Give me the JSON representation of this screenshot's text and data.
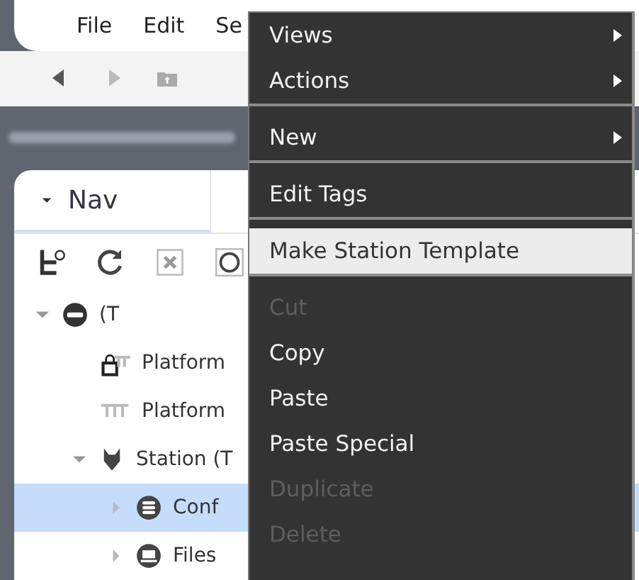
{
  "menu_bar": {
    "items": [
      "File",
      "Edit",
      "Se"
    ]
  },
  "nav_panel": {
    "tab": {
      "label": "Nav",
      "expanded": true
    },
    "tree": [
      {
        "label": "(T",
        "kind": "server",
        "expanded": true,
        "selected": false,
        "children": [
          {
            "label": "Platform",
            "kind": "platform-lock",
            "selected": false
          },
          {
            "label": "Platform",
            "kind": "platform",
            "selected": false
          },
          {
            "label": "Station (T",
            "kind": "station",
            "expanded": true,
            "selected": false,
            "children": [
              {
                "label": "Conf",
                "kind": "database",
                "expanded": false,
                "selected": true
              },
              {
                "label": "Files",
                "kind": "drive",
                "expanded": false,
                "selected": false
              }
            ]
          }
        ]
      }
    ]
  },
  "context_menu": {
    "items": [
      {
        "kind": "item",
        "label": "Views",
        "submenu": true,
        "disabled": false,
        "selected": false
      },
      {
        "kind": "item",
        "label": "Actions",
        "submenu": true,
        "disabled": false,
        "selected": false
      },
      {
        "kind": "separator"
      },
      {
        "kind": "item",
        "label": "New",
        "submenu": true,
        "disabled": false,
        "selected": false
      },
      {
        "kind": "separator"
      },
      {
        "kind": "item",
        "label": "Edit Tags",
        "submenu": false,
        "disabled": false,
        "selected": false
      },
      {
        "kind": "separator"
      },
      {
        "kind": "item",
        "label": "Make Station Template",
        "submenu": false,
        "disabled": false,
        "selected": true
      },
      {
        "kind": "separator"
      },
      {
        "kind": "item",
        "label": "Cut",
        "submenu": false,
        "disabled": true,
        "selected": false
      },
      {
        "kind": "item",
        "label": "Copy",
        "submenu": false,
        "disabled": false,
        "selected": false
      },
      {
        "kind": "item",
        "label": "Paste",
        "submenu": false,
        "disabled": false,
        "selected": false
      },
      {
        "kind": "item",
        "label": "Paste Special",
        "submenu": false,
        "disabled": false,
        "selected": false
      },
      {
        "kind": "item",
        "label": "Duplicate",
        "submenu": false,
        "disabled": true,
        "selected": false
      },
      {
        "kind": "item",
        "label": "Delete",
        "submenu": false,
        "disabled": true,
        "selected": false
      }
    ]
  }
}
